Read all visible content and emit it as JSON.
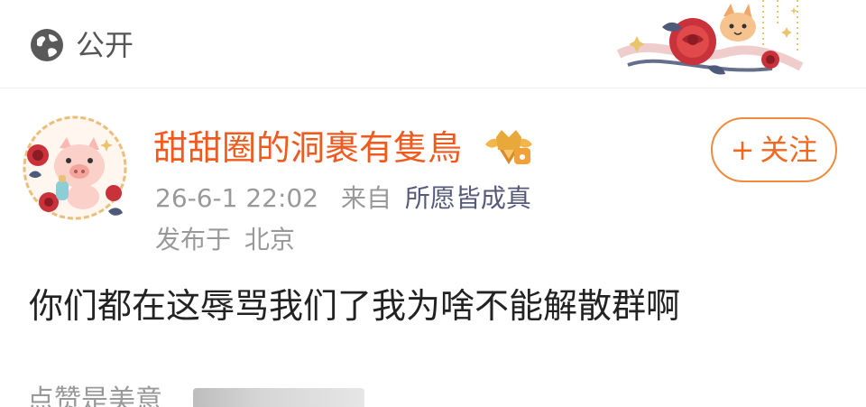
{
  "visibility": {
    "icon": "globe-icon",
    "label": "公开"
  },
  "header_decoration": {
    "icon": "rose-fox-decoration"
  },
  "author": {
    "avatar_icon": "piglet-rose-avatar",
    "name": "甜甜圈的洞裹有隻鳥",
    "name_color": "#f05a1e",
    "badge_icon": "crown-member-badge"
  },
  "follow_button": {
    "plus": "+",
    "label": "关注",
    "color": "#f06a1e"
  },
  "meta": {
    "timestamp": "26-6-1 22:02",
    "source_prefix": "来自",
    "source_app": "所愿皆成真"
  },
  "location": {
    "prefix": "发布于",
    "city": "北京"
  },
  "post": {
    "text": "你们都在这辱骂我们了我为啥不能解散群啊"
  },
  "footer_partial": {
    "text": "点赞是美意"
  }
}
